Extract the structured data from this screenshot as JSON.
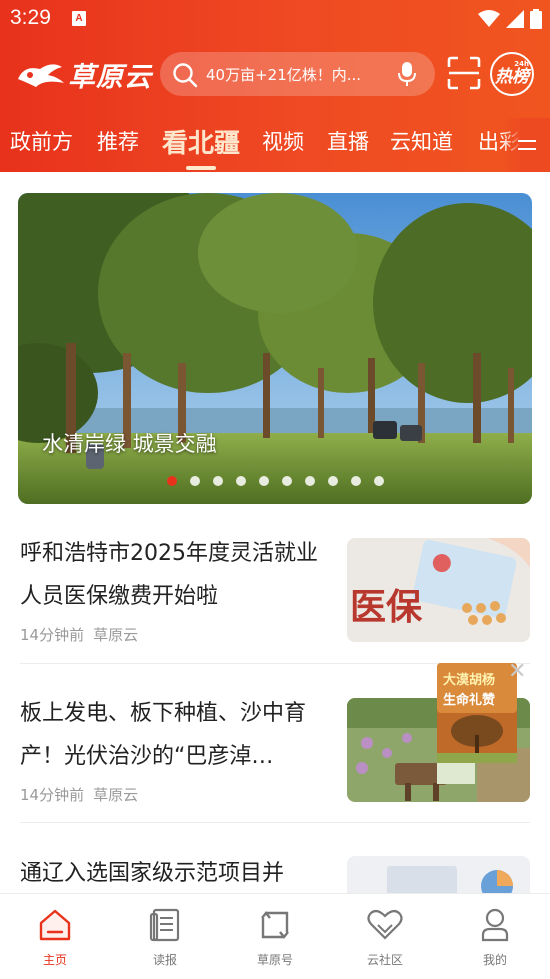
{
  "status_bar": {
    "time": "3:29",
    "sim_letter": "A",
    "icons": [
      "wifi-icon",
      "signal-icon",
      "battery-icon"
    ]
  },
  "header": {
    "logo_text": "草原云",
    "search_placeholder": "40万亩+21亿株！内...",
    "hot_label": "热榜",
    "hot_sup": "24h",
    "colors": {
      "header_red": "#e8321c",
      "active_tab": "#fde6cc"
    }
  },
  "tabs": [
    {
      "label": "政前方"
    },
    {
      "label": "推荐"
    },
    {
      "label": "看北疆",
      "active": true
    },
    {
      "label": "视频"
    },
    {
      "label": "直播"
    },
    {
      "label": "云知道"
    },
    {
      "label": "出彩"
    }
  ],
  "banner": {
    "caption": "水清岸绿 城景交融",
    "slide_count": 10,
    "active_slide": 1
  },
  "news": [
    {
      "title": "呼和浩特市2025年度灵活就业人员医保缴费开始啦",
      "time": "14分钟前",
      "source": "草原云",
      "thumb_text": "医保"
    },
    {
      "title": "板上发电、板下种植、沙中育产！光伏治沙的“巴彦淖…",
      "time": "14分钟前",
      "source": "草原云",
      "thumb_text": ""
    },
    {
      "title": "通辽入选国家级示范项目并",
      "time": "",
      "source": "",
      "thumb_text": ""
    }
  ],
  "floating_ad": {
    "line1": "大漠胡杨",
    "line2": "生命礼赞"
  },
  "bottom_nav": [
    {
      "label": "主页",
      "icon": "home-icon",
      "active": true
    },
    {
      "label": "读报",
      "icon": "newspaper-icon"
    },
    {
      "label": "草原号",
      "icon": "repost-icon"
    },
    {
      "label": "云社区",
      "icon": "community-heart-icon"
    },
    {
      "label": "我的",
      "icon": "profile-icon"
    }
  ]
}
